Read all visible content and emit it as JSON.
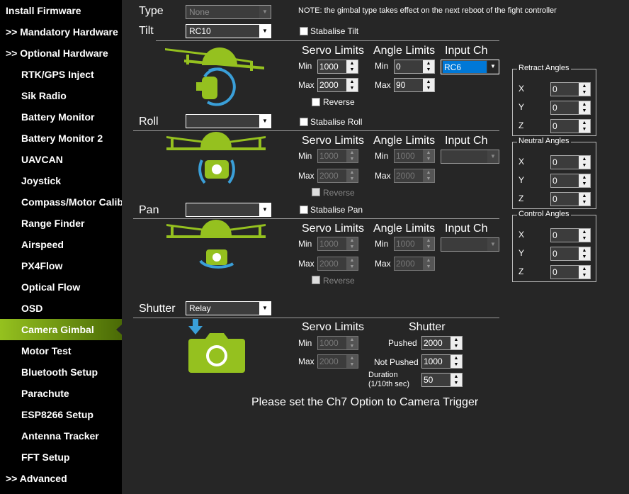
{
  "sidebar": {
    "items": [
      {
        "label": "Install Firmware",
        "level": "top"
      },
      {
        "label": ">> Mandatory Hardware",
        "level": "top"
      },
      {
        "label": ">> Optional Hardware",
        "level": "top"
      },
      {
        "label": "RTK/GPS Inject",
        "level": "sub"
      },
      {
        "label": "Sik Radio",
        "level": "sub"
      },
      {
        "label": "Battery Monitor",
        "level": "sub"
      },
      {
        "label": "Battery Monitor 2",
        "level": "sub"
      },
      {
        "label": "UAVCAN",
        "level": "sub"
      },
      {
        "label": "Joystick",
        "level": "sub"
      },
      {
        "label": "Compass/Motor Calib",
        "level": "sub"
      },
      {
        "label": "Range Finder",
        "level": "sub"
      },
      {
        "label": "Airspeed",
        "level": "sub"
      },
      {
        "label": "PX4Flow",
        "level": "sub"
      },
      {
        "label": "Optical Flow",
        "level": "sub"
      },
      {
        "label": "OSD",
        "level": "sub"
      },
      {
        "label": "Camera Gimbal",
        "level": "sub",
        "selected": true
      },
      {
        "label": "Motor Test",
        "level": "sub"
      },
      {
        "label": "Bluetooth Setup",
        "level": "sub"
      },
      {
        "label": "Parachute",
        "level": "sub"
      },
      {
        "label": "ESP8266 Setup",
        "level": "sub"
      },
      {
        "label": "Antenna Tracker",
        "level": "sub"
      },
      {
        "label": "FFT Setup",
        "level": "sub"
      },
      {
        "label": ">> Advanced",
        "level": "top"
      }
    ]
  },
  "type": {
    "label": "Type",
    "value": "None",
    "note": "NOTE: the gimbal type takes effect on the next reboot of the fight controller"
  },
  "headers": {
    "servo": "Servo Limits",
    "angle": "Angle Limits",
    "input": "Input Ch",
    "min": "Min",
    "max": "Max",
    "reverse": "Reverse",
    "shutter": "Shutter"
  },
  "tilt": {
    "label": "Tilt",
    "value": "RC10",
    "stabilise": "Stabalise Tilt",
    "servo_min": "1000",
    "servo_max": "2000",
    "angle_min": "0",
    "angle_max": "90",
    "input": "RC6"
  },
  "roll": {
    "label": "Roll",
    "value": "",
    "stabilise": "Stabalise Roll",
    "servo_min": "1000",
    "servo_max": "2000",
    "angle_min": "1000",
    "angle_max": "2000",
    "input": ""
  },
  "pan": {
    "label": "Pan",
    "value": "",
    "stabilise": "Stabalise Pan",
    "servo_min": "1000",
    "servo_max": "2000",
    "angle_min": "1000",
    "angle_max": "2000",
    "input": ""
  },
  "shutter": {
    "label": "Shutter",
    "value": "Relay",
    "servo_min": "1000",
    "servo_max": "2000",
    "pushed_label": "Pushed",
    "pushed": "2000",
    "not_pushed_label": "Not Pushed",
    "not_pushed": "1000",
    "duration_label": "Duration",
    "duration_unit": "(1/10th sec)",
    "duration": "50",
    "message": "Please set the Ch7 Option to Camera Trigger"
  },
  "angles": {
    "retract": {
      "title": "Retract Angles",
      "x": "0",
      "y": "0",
      "z": "0"
    },
    "neutral": {
      "title": "Neutral Angles",
      "x": "0",
      "y": "0",
      "z": "0"
    },
    "control": {
      "title": "Control Angles",
      "x": "0",
      "y": "0",
      "z": "0"
    },
    "x_label": "X",
    "y_label": "Y",
    "z_label": "Z"
  },
  "colors": {
    "accent_green": "#95c11f",
    "icon_blue": "#3a9fd8",
    "selection_blue": "#0078d7"
  }
}
